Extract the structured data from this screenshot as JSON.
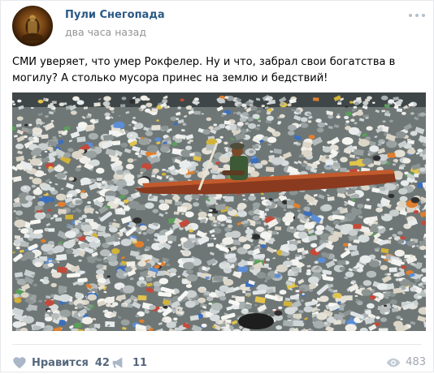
{
  "post": {
    "author": "Пули Снегопада",
    "time": "два часа назад",
    "text": "СМИ уверяет, что умер Рокфелер. Ну и что, забрал свои богатства в могилу? А столько мусора принес на землю и бедствий!"
  },
  "footer": {
    "like_label": "Нравится",
    "like_count": "42",
    "share_count": "11",
    "views_count": "483"
  },
  "icons": {
    "like": "heart-icon",
    "share": "megaphone-icon",
    "views": "eye-icon",
    "more": "more-dots-icon"
  },
  "colors": {
    "author": "#2a5885",
    "time": "#939393",
    "footer": "#55677d"
  }
}
